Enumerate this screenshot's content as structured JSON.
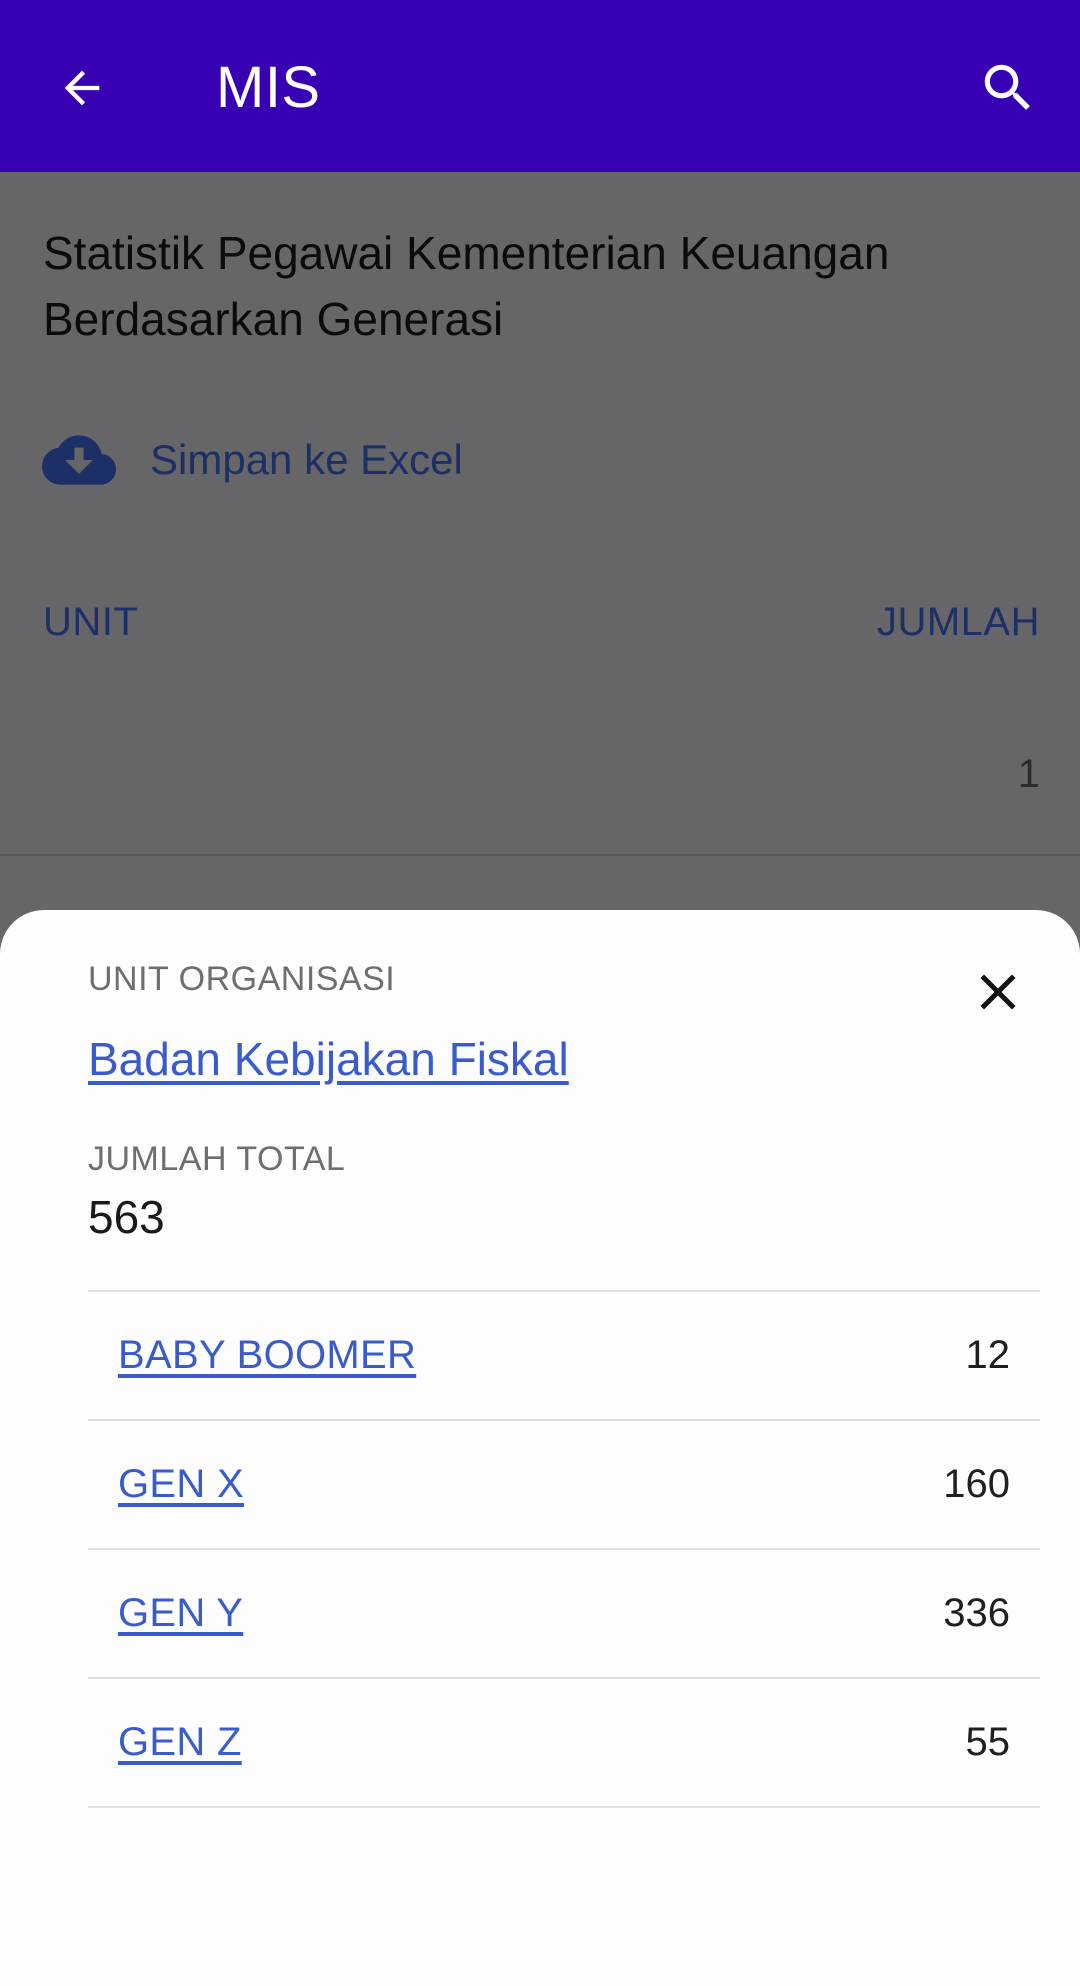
{
  "app_bar": {
    "title": "MIS",
    "background": "#3700b3",
    "back_icon": "arrow-left-icon",
    "search_icon": "search-icon"
  },
  "page": {
    "title": "Statistik Pegawai Kementerian Keuangan Berdasarkan Generasi",
    "export_label": "Simpan ke Excel",
    "export_icon": "cloud-download-icon",
    "table": {
      "columns": [
        "UNIT",
        "JUMLAH"
      ],
      "rows": [
        {
          "unit": "",
          "jumlah": "1"
        }
      ]
    }
  },
  "sheet": {
    "unit_label": "UNIT ORGANISASI",
    "unit_name": "Badan Kebijakan Fiskal",
    "total_label": "JUMLAH TOTAL",
    "total_value": "563",
    "close_icon": "close-icon",
    "generations": [
      {
        "name": "BABY BOOMER",
        "count": "12"
      },
      {
        "name": "GEN X",
        "count": "160"
      },
      {
        "name": "GEN Y",
        "count": "336"
      },
      {
        "name": "GEN Z",
        "count": "55"
      }
    ],
    "link_color": "#3a5bcc"
  }
}
